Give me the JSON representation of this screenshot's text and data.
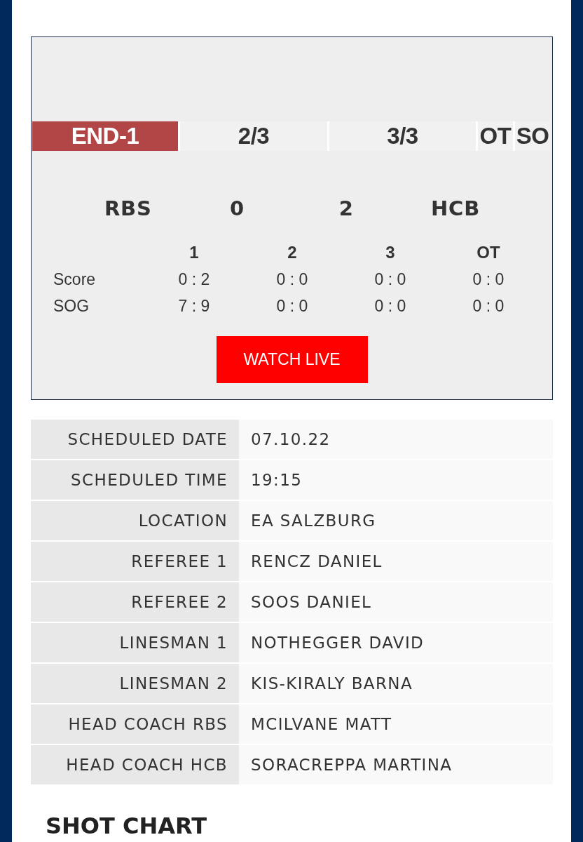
{
  "scoreboard": {
    "tabs": [
      {
        "label": "END-1",
        "selected": true
      },
      {
        "label": "2/3",
        "selected": false
      },
      {
        "label": "3/3",
        "selected": false
      },
      {
        "label": "OT",
        "selected": false
      },
      {
        "label": "SO",
        "selected": false
      }
    ],
    "teams": {
      "home": "RBS",
      "home_score": "0",
      "away_score": "2",
      "away": "HCB"
    },
    "periods": {
      "columns": [
        "1",
        "2",
        "3",
        "OT"
      ],
      "rows": [
        {
          "label": "Score",
          "values": [
            "0 : 2",
            "0 : 0",
            "0 : 0",
            "0 : 0"
          ]
        },
        {
          "label": "SOG",
          "values": [
            "7 : 9",
            "0 : 0",
            "0 : 0",
            "0 : 0"
          ]
        }
      ]
    },
    "watch_button": "WATCH LIVE"
  },
  "game_info": [
    {
      "label": "SCHEDULED DATE",
      "value": "07.10.22"
    },
    {
      "label": "SCHEDULED TIME",
      "value": "19:15"
    },
    {
      "label": "LOCATION",
      "value": "EA SALZBURG"
    },
    {
      "label": "REFEREE 1",
      "value": "RENCZ DANIEL"
    },
    {
      "label": "REFEREE 2",
      "value": "SOOS DANIEL"
    },
    {
      "label": "LINESMAN 1",
      "value": "NOTHEGGER DAVID"
    },
    {
      "label": "LINESMAN 2",
      "value": "KIS-KIRALY BARNA"
    },
    {
      "label": "HEAD COACH RBS",
      "value": "MCILVANE MATT"
    },
    {
      "label": "HEAD COACH HCB",
      "value": "SORACREPPA MARTINA"
    }
  ],
  "section_heading": "SHOT CHART"
}
